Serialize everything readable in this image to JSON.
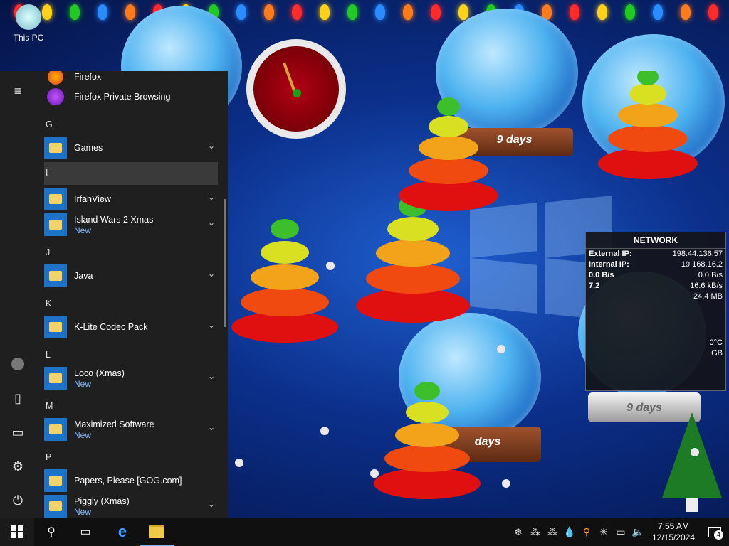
{
  "desktop": {
    "icons": [
      {
        "label": "This PC",
        "icon": "this-pc-icon"
      }
    ],
    "globe_labels": [
      "9 days",
      "9 days",
      "days"
    ],
    "network_widget": {
      "title": "NETWORK",
      "rows": [
        {
          "label": "External IP:",
          "value": "198.44.136.57"
        },
        {
          "label": "Internal IP:",
          "value": "19 168.16.2"
        },
        {
          "label": "0.0 B/s",
          "value": "0.0 B/s"
        },
        {
          "label": "7.2",
          "value": "16.6 kB/s"
        }
      ],
      "partial_values": [
        "0°C",
        "GB",
        "24.4 MB"
      ]
    }
  },
  "start_menu": {
    "menu_icon": "hamburger-icon",
    "rail": [
      {
        "name": "user",
        "icon": "user-icon"
      },
      {
        "name": "documents",
        "icon": "document-icon"
      },
      {
        "name": "pictures",
        "icon": "pictures-icon"
      },
      {
        "name": "settings",
        "icon": "gear-icon"
      },
      {
        "name": "power",
        "icon": "power-icon"
      }
    ],
    "entries": [
      {
        "type": "app",
        "label": "Firefox",
        "sub": ""
      },
      {
        "type": "app",
        "label": "Firefox Private Browsing",
        "sub": ""
      },
      {
        "type": "letter",
        "label": "G"
      },
      {
        "type": "folder",
        "label": "Games",
        "sub": ""
      },
      {
        "type": "letter",
        "label": "I"
      },
      {
        "type": "folder",
        "label": "IrfanView",
        "sub": ""
      },
      {
        "type": "folder",
        "label": "Island Wars 2 Xmas",
        "sub": "New"
      },
      {
        "type": "letter",
        "label": "J"
      },
      {
        "type": "folder",
        "label": "Java",
        "sub": ""
      },
      {
        "type": "letter",
        "label": "K"
      },
      {
        "type": "folder",
        "label": "K-Lite Codec Pack",
        "sub": ""
      },
      {
        "type": "letter",
        "label": "L"
      },
      {
        "type": "folder",
        "label": "Loco (Xmas)",
        "sub": "New"
      },
      {
        "type": "letter",
        "label": "M"
      },
      {
        "type": "folder",
        "label": "Maximized Software",
        "sub": "New"
      },
      {
        "type": "letter",
        "label": "P"
      },
      {
        "type": "folder",
        "label": "Papers, Please [GOG.com]",
        "sub": ""
      },
      {
        "type": "folder",
        "label": "Piggly (Xmas)",
        "sub": "New"
      }
    ]
  },
  "taskbar": {
    "buttons": [
      "start",
      "search",
      "task-view",
      "internet-explorer",
      "file-explorer"
    ],
    "time": "7:55 AM",
    "date": "12/15/2024",
    "notification_count": "4"
  },
  "colors": {
    "accent": "#1e73c9",
    "new_badge": "#7fb7ff",
    "start_bg": "#1f1f1f",
    "taskbar_bg": "#101010"
  }
}
